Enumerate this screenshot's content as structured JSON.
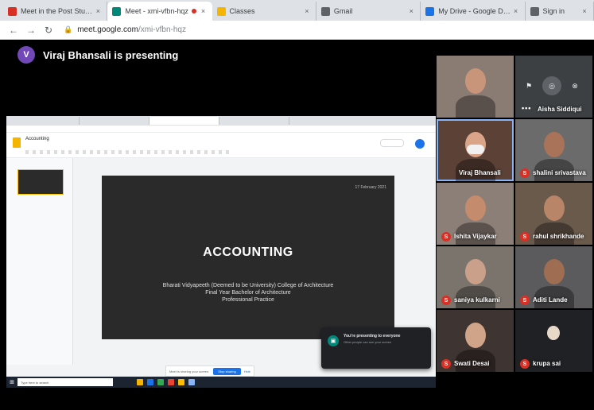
{
  "browser": {
    "tabs": [
      {
        "title": "Meet in the Post Studio",
        "favicon_color": "#d93025"
      },
      {
        "title": "Meet - xmi-vfbn-hqz",
        "favicon_color": "#00897b",
        "active": true,
        "recording": true
      },
      {
        "title": "Classes",
        "favicon_color": "#f4b400"
      },
      {
        "title": "Gmail",
        "favicon_color": "#5f6368"
      },
      {
        "title": "My Drive - Google Drive",
        "favicon_color": "#1a73e8"
      },
      {
        "title": "Sign in",
        "favicon_color": "#5f6368"
      }
    ],
    "url_host": "meet.google.com",
    "url_path": "/xmi-vfbn-hqz"
  },
  "meet": {
    "presenter_initial": "V",
    "presenter_text": "Viraj Bhansali is presenting",
    "presenter_color": "#7248b9"
  },
  "shared_screen": {
    "doc_title": "Accounting",
    "slide": {
      "date": "17 February 2021",
      "title": "ACCOUNTING",
      "subtitle_lines": [
        "Bharati Vidyapeeth (Deemed to be University) College of Architecture",
        "Final Year Bachelor of Architecture",
        "Professional Practice"
      ]
    },
    "notice_text": "Meet is sharing your screen.",
    "notice_button": "Stop sharing",
    "notice_hide": "Hide",
    "taskbar_search": "Type here to search"
  },
  "toast": {
    "title": "You're presenting to everyone",
    "body": "Other people can see your screen"
  },
  "participants": [
    {
      "name": "",
      "initial": "",
      "speaking": false,
      "bg": "#8a7c73"
    },
    {
      "name": "Aisha Siddiqui",
      "initial": "",
      "speaking": false,
      "bg": "#3c4043"
    },
    {
      "name": "Viraj Bhansali",
      "initial": "",
      "speaking": true,
      "bg": "#5b4136"
    },
    {
      "name": "shalini srivastava",
      "initial": "S",
      "speaking": false,
      "bg": "#6b6b6b"
    },
    {
      "name": "Ishita Vijaykar",
      "initial": "S",
      "speaking": false,
      "bg": "#8c7f77"
    },
    {
      "name": "rahul shrikhande",
      "initial": "S",
      "speaking": false,
      "bg": "#6a5a4c"
    },
    {
      "name": "saniya kulkarni",
      "initial": "S",
      "speaking": false,
      "bg": "#7a746c"
    },
    {
      "name": "Aditi Lande",
      "initial": "S",
      "speaking": false,
      "bg": "#5b5a5c"
    },
    {
      "name": "Swati Desai",
      "initial": "S",
      "speaking": false,
      "bg": "#3e3431"
    },
    {
      "name": "krupa sai",
      "initial": "S",
      "speaking": false,
      "bg": "#202124"
    }
  ],
  "icons": {
    "back": "arrow-left-icon",
    "forward": "arrow-right-icon",
    "reload": "reload-icon",
    "lock": "lock-icon",
    "pin": "pin-icon",
    "mute": "mic-off-icon",
    "remove": "remove-icon",
    "more": "more-icon"
  }
}
